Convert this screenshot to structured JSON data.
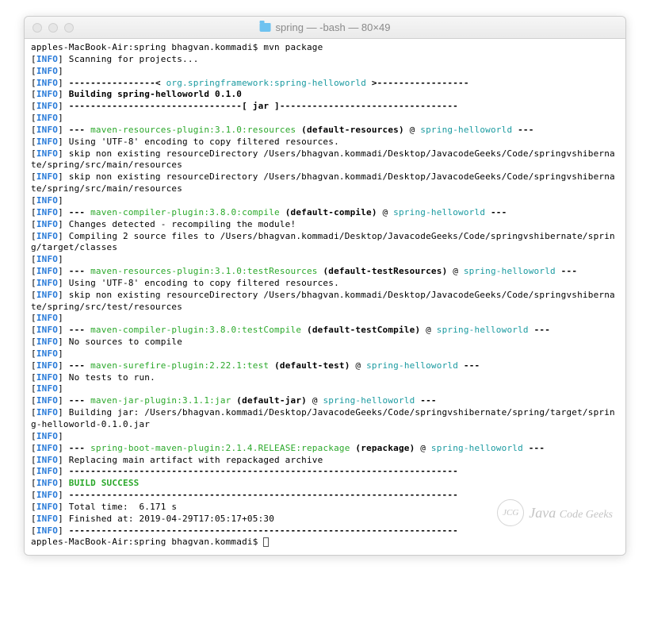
{
  "title": "spring — -bash — 80×49",
  "prompt_line": "apples-MacBook-Air:spring bhagvan.kommadi$ mvn package",
  "lines": [
    {
      "info": true,
      "segs": [
        {
          "t": " Scanning for projects..."
        }
      ]
    },
    {
      "info": true,
      "segs": []
    },
    {
      "info": true,
      "segs": [
        {
          "t": " "
        },
        {
          "t": "----------------< ",
          "cls": "bold"
        },
        {
          "t": "org.springframework:spring-helloworld",
          "cls": "cyan"
        },
        {
          "t": " >-----------------",
          "cls": "bold"
        }
      ]
    },
    {
      "info": true,
      "segs": [
        {
          "t": " "
        },
        {
          "t": "Building spring-helloworld 0.1.0",
          "cls": "bold"
        }
      ]
    },
    {
      "info": true,
      "segs": [
        {
          "t": " "
        },
        {
          "t": "--------------------------------[ jar ]---------------------------------",
          "cls": "bold"
        }
      ]
    },
    {
      "info": true,
      "segs": []
    },
    {
      "info": true,
      "segs": [
        {
          "t": " "
        },
        {
          "t": "--- ",
          "cls": "bold"
        },
        {
          "t": "maven-resources-plugin:3.1.0:resources",
          "cls": "green"
        },
        {
          "t": " "
        },
        {
          "t": "(default-resources)",
          "cls": "bold"
        },
        {
          "t": " @ "
        },
        {
          "t": "spring-helloworld",
          "cls": "cyan"
        },
        {
          "t": " "
        },
        {
          "t": "---",
          "cls": "bold"
        }
      ]
    },
    {
      "info": true,
      "segs": [
        {
          "t": " Using 'UTF-8' encoding to copy filtered resources."
        }
      ]
    },
    {
      "info": true,
      "segs": [
        {
          "t": " skip non existing resourceDirectory /Users/bhagvan.kommadi/Desktop/JavacodeGeeks/Code/springvshibernate/spring/src/main/resources"
        }
      ]
    },
    {
      "info": true,
      "segs": [
        {
          "t": " skip non existing resourceDirectory /Users/bhagvan.kommadi/Desktop/JavacodeGeeks/Code/springvshibernate/spring/src/main/resources"
        }
      ]
    },
    {
      "info": true,
      "segs": []
    },
    {
      "info": true,
      "segs": [
        {
          "t": " "
        },
        {
          "t": "--- ",
          "cls": "bold"
        },
        {
          "t": "maven-compiler-plugin:3.8.0:compile",
          "cls": "green"
        },
        {
          "t": " "
        },
        {
          "t": "(default-compile)",
          "cls": "bold"
        },
        {
          "t": " @ "
        },
        {
          "t": "spring-helloworld",
          "cls": "cyan"
        },
        {
          "t": " "
        },
        {
          "t": "---",
          "cls": "bold"
        }
      ]
    },
    {
      "info": true,
      "segs": [
        {
          "t": " Changes detected - recompiling the module!"
        }
      ]
    },
    {
      "info": true,
      "segs": [
        {
          "t": " Compiling 2 source files to /Users/bhagvan.kommadi/Desktop/JavacodeGeeks/Code/springvshibernate/spring/target/classes"
        }
      ]
    },
    {
      "info": true,
      "segs": []
    },
    {
      "info": true,
      "segs": [
        {
          "t": " "
        },
        {
          "t": "--- ",
          "cls": "bold"
        },
        {
          "t": "maven-resources-plugin:3.1.0:testResources",
          "cls": "green"
        },
        {
          "t": " "
        },
        {
          "t": "(default-testResources)",
          "cls": "bold"
        },
        {
          "t": " @ "
        },
        {
          "t": "spring-helloworld",
          "cls": "cyan"
        },
        {
          "t": " "
        },
        {
          "t": "---",
          "cls": "bold"
        }
      ]
    },
    {
      "info": true,
      "segs": [
        {
          "t": " Using 'UTF-8' encoding to copy filtered resources."
        }
      ]
    },
    {
      "info": true,
      "segs": [
        {
          "t": " skip non existing resourceDirectory /Users/bhagvan.kommadi/Desktop/JavacodeGeeks/Code/springvshibernate/spring/src/test/resources"
        }
      ]
    },
    {
      "info": true,
      "segs": []
    },
    {
      "info": true,
      "segs": [
        {
          "t": " "
        },
        {
          "t": "--- ",
          "cls": "bold"
        },
        {
          "t": "maven-compiler-plugin:3.8.0:testCompile",
          "cls": "green"
        },
        {
          "t": " "
        },
        {
          "t": "(default-testCompile)",
          "cls": "bold"
        },
        {
          "t": " @ "
        },
        {
          "t": "spring-helloworld",
          "cls": "cyan"
        },
        {
          "t": " "
        },
        {
          "t": "---",
          "cls": "bold"
        }
      ]
    },
    {
      "info": true,
      "segs": [
        {
          "t": " No sources to compile"
        }
      ]
    },
    {
      "info": true,
      "segs": []
    },
    {
      "info": true,
      "segs": [
        {
          "t": " "
        },
        {
          "t": "--- ",
          "cls": "bold"
        },
        {
          "t": "maven-surefire-plugin:2.22.1:test",
          "cls": "green"
        },
        {
          "t": " "
        },
        {
          "t": "(default-test)",
          "cls": "bold"
        },
        {
          "t": " @ "
        },
        {
          "t": "spring-helloworld",
          "cls": "cyan"
        },
        {
          "t": " "
        },
        {
          "t": "---",
          "cls": "bold"
        }
      ]
    },
    {
      "info": true,
      "segs": [
        {
          "t": " No tests to run."
        }
      ]
    },
    {
      "info": true,
      "segs": []
    },
    {
      "info": true,
      "segs": [
        {
          "t": " "
        },
        {
          "t": "--- ",
          "cls": "bold"
        },
        {
          "t": "maven-jar-plugin:3.1.1:jar",
          "cls": "green"
        },
        {
          "t": " "
        },
        {
          "t": "(default-jar)",
          "cls": "bold"
        },
        {
          "t": " @ "
        },
        {
          "t": "spring-helloworld",
          "cls": "cyan"
        },
        {
          "t": " "
        },
        {
          "t": "---",
          "cls": "bold"
        }
      ]
    },
    {
      "info": true,
      "segs": [
        {
          "t": " Building jar: /Users/bhagvan.kommadi/Desktop/JavacodeGeeks/Code/springvshibernate/spring/target/spring-helloworld-0.1.0.jar"
        }
      ]
    },
    {
      "info": true,
      "segs": []
    },
    {
      "info": true,
      "segs": [
        {
          "t": " "
        },
        {
          "t": "--- ",
          "cls": "bold"
        },
        {
          "t": "spring-boot-maven-plugin:2.1.4.RELEASE:repackage",
          "cls": "green"
        },
        {
          "t": " "
        },
        {
          "t": "(repackage)",
          "cls": "bold"
        },
        {
          "t": " @ "
        },
        {
          "t": "spring-helloworld",
          "cls": "cyan"
        },
        {
          "t": " "
        },
        {
          "t": "---",
          "cls": "bold"
        }
      ]
    },
    {
      "info": true,
      "segs": [
        {
          "t": " Replacing main artifact with repackaged archive"
        }
      ]
    },
    {
      "info": true,
      "segs": [
        {
          "t": " "
        },
        {
          "t": "------------------------------------------------------------------------",
          "cls": "bold"
        }
      ]
    },
    {
      "info": true,
      "segs": [
        {
          "t": " "
        },
        {
          "t": "BUILD SUCCESS",
          "cls": "green bold"
        }
      ]
    },
    {
      "info": true,
      "segs": [
        {
          "t": " "
        },
        {
          "t": "------------------------------------------------------------------------",
          "cls": "bold"
        }
      ]
    },
    {
      "info": true,
      "segs": [
        {
          "t": " Total time:  6.171 s"
        }
      ]
    },
    {
      "info": true,
      "segs": [
        {
          "t": " Finished at: 2019-04-29T17:05:17+05:30"
        }
      ]
    },
    {
      "info": true,
      "segs": [
        {
          "t": " "
        },
        {
          "t": "------------------------------------------------------------------------",
          "cls": "bold"
        }
      ]
    }
  ],
  "prompt2": "apples-MacBook-Air:spring bhagvan.kommadi$ ",
  "info_label": "INFO",
  "watermark": {
    "badge": "JCG",
    "main": "Java ",
    "sub": "Code Geeks"
  }
}
